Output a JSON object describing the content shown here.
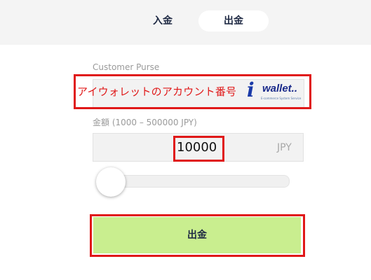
{
  "tabs": {
    "deposit": "入金",
    "withdraw": "出金",
    "active": "withdraw"
  },
  "purse": {
    "label": "Customer Purse",
    "annotation": "アイウォレットのアカウント番号",
    "logo_text": "wallet..",
    "logo_subtext": "E-commerce System Service"
  },
  "amount": {
    "label": "金額 (1000 – 500000 JPY)",
    "value": "10000",
    "unit": "JPY",
    "slider_fraction": 0.0
  },
  "submit": {
    "label": "出金"
  },
  "colors": {
    "annotation": "#e01818",
    "submit_bg": "#c9ee8f",
    "topbar_bg": "#f4f4f4"
  }
}
